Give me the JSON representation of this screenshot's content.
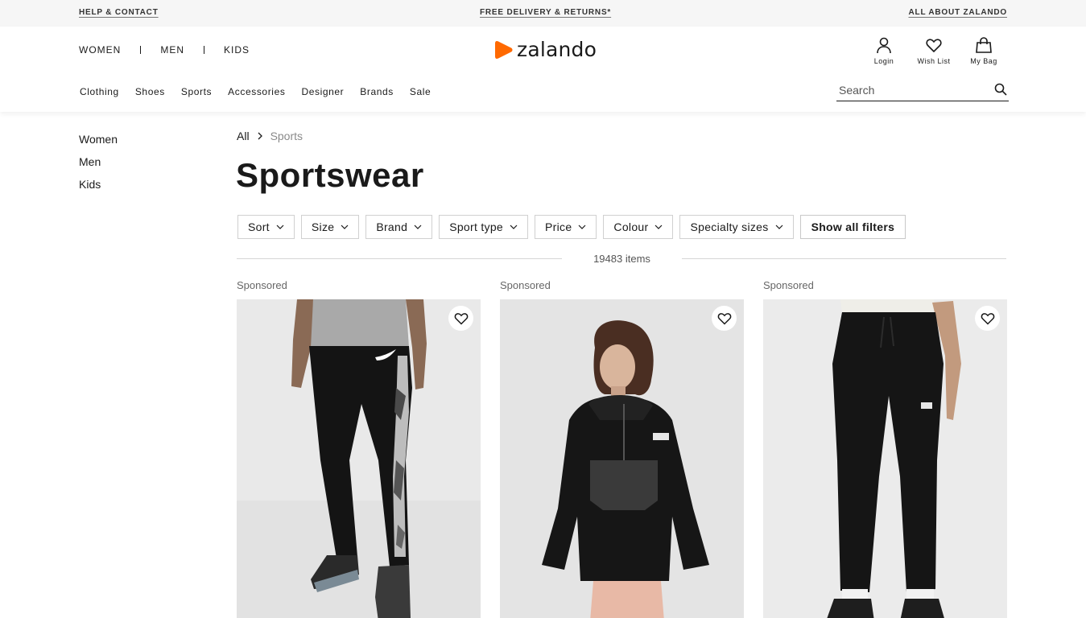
{
  "utility": {
    "help": "HELP & CONTACT",
    "delivery": "FREE DELIVERY & RETURNS*",
    "about": "ALL ABOUT ZALANDO"
  },
  "gender_nav": [
    "WOMEN",
    "MEN",
    "KIDS"
  ],
  "brand": {
    "name": "zalando",
    "accent": "#ff6900"
  },
  "user_actions": {
    "login": "Login",
    "wishlist": "Wish List",
    "bag": "My Bag"
  },
  "categories": [
    "Clothing",
    "Shoes",
    "Sports",
    "Accessories",
    "Designer",
    "Brands",
    "Sale"
  ],
  "search": {
    "placeholder": "Search"
  },
  "sidebar": {
    "items": [
      "Women",
      "Men",
      "Kids"
    ]
  },
  "breadcrumb": {
    "root": "All",
    "current": "Sports"
  },
  "page_title": "Sportswear",
  "filters": [
    "Sort",
    "Size",
    "Brand",
    "Sport type",
    "Price",
    "Colour",
    "Specialty sizes"
  ],
  "show_all_filters": "Show all filters",
  "item_count": "19483 items",
  "products": [
    {
      "label": "Sponsored",
      "image": "black track pants with camo side stripe",
      "icon": "heart-icon"
    },
    {
      "label": "Sponsored",
      "image": "black half-zip anorak jacket",
      "icon": "heart-icon"
    },
    {
      "label": "Sponsored",
      "image": "black jogger sweatpants",
      "icon": "heart-icon"
    }
  ]
}
